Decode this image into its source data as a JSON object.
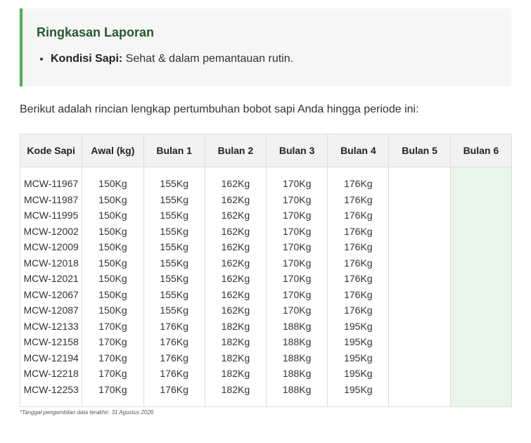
{
  "summary": {
    "title": "Ringkasan Laporan",
    "items": [
      {
        "key": "Kondisi Sapi:",
        "value": " Sehat & dalam pemantauan rutin."
      }
    ]
  },
  "intro_text": "Berikut adalah rincian lengkap pertumbuhan bobot sapi Anda hingga periode ini:",
  "table": {
    "headers": [
      "Kode Sapi",
      "Awal (kg)",
      "Bulan 1",
      "Bulan 2",
      "Bulan 3",
      "Bulan 4",
      "Bulan 5",
      "Bulan 6"
    ],
    "columns": [
      [
        "MCW-11967",
        "MCW-11987",
        "MCW-11995",
        "MCW-12002",
        "MCW-12009",
        "MCW-12018",
        "MCW-12021",
        "MCW-12067",
        "MCW-12087",
        "MCW-12133",
        "MCW-12158",
        "MCW-12194",
        "MCW-12218",
        "MCW-12253"
      ],
      [
        "150Kg",
        "150Kg",
        "150Kg",
        "150Kg",
        "150Kg",
        "150Kg",
        "150Kg",
        "150Kg",
        "150Kg",
        "170Kg",
        "170Kg",
        "170Kg",
        "170Kg",
        "170Kg"
      ],
      [
        "155Kg",
        "155Kg",
        "155Kg",
        "155Kg",
        "155Kg",
        "155Kg",
        "155Kg",
        "155Kg",
        "155Kg",
        "176Kg",
        "176Kg",
        "176Kg",
        "176Kg",
        "176Kg"
      ],
      [
        "162Kg",
        "162Kg",
        "162Kg",
        "162Kg",
        "162Kg",
        "162Kg",
        "162Kg",
        "162Kg",
        "162Kg",
        "182Kg",
        "182Kg",
        "182Kg",
        "182Kg",
        "182Kg"
      ],
      [
        "170Kg",
        "170Kg",
        "170Kg",
        "170Kg",
        "170Kg",
        "170Kg",
        "170Kg",
        "170Kg",
        "170Kg",
        "188Kg",
        "188Kg",
        "188Kg",
        "188Kg",
        "188Kg"
      ],
      [
        "176Kg",
        "176Kg",
        "176Kg",
        "176Kg",
        "176Kg",
        "176Kg",
        "176Kg",
        "176Kg",
        "176Kg",
        "195Kg",
        "195Kg",
        "195Kg",
        "195Kg",
        "195Kg"
      ],
      [],
      []
    ]
  },
  "footnote": "*Tanggal pengambilan data terakhir: 31 Agustus 2026",
  "colors": {
    "accent_green": "#4caf50",
    "title_green": "#245a2c",
    "highlight_column": "#e8f5e9"
  }
}
